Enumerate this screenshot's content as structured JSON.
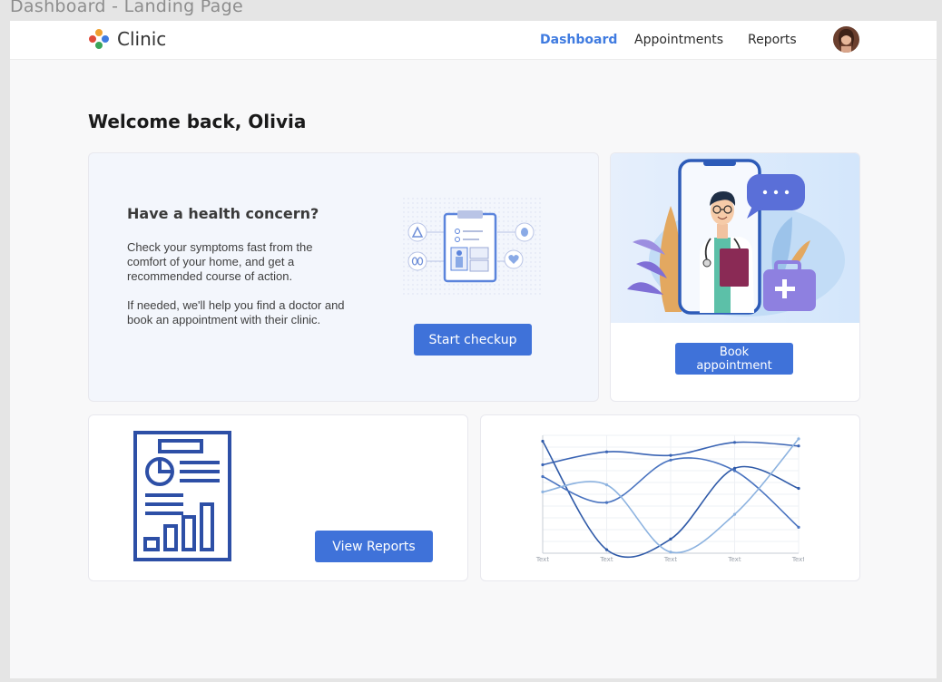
{
  "frame_title": "Dashboard - Landing Page",
  "header": {
    "app_name": "Clinic",
    "nav": [
      {
        "label": "Dashboard",
        "active": true
      },
      {
        "label": "Appointments",
        "active": false
      },
      {
        "label": "Reports",
        "active": false
      }
    ]
  },
  "welcome": "Welcome back, Olivia",
  "concern_card": {
    "title": "Have a health concern?",
    "paragraph1": "Check your symptoms fast from the comfort of your home, and get a recommended course of action.",
    "paragraph2": "If needed, we'll help you find a doctor and book an appointment with their clinic.",
    "button": "Start checkup"
  },
  "appointment_card": {
    "button": "Book appointment"
  },
  "reports_card": {
    "button": "View Reports"
  },
  "colors": {
    "accent": "#3f72d9",
    "nav_active": "#3f7be0"
  },
  "chart_data": {
    "type": "line",
    "categories": [
      "Text",
      "Text",
      "Text",
      "Text",
      "Text"
    ],
    "ylim": [
      0,
      1
    ],
    "series": [
      {
        "values": [
          0.75,
          0.86,
          0.83,
          0.94,
          0.91
        ],
        "color": "#3a64b4"
      },
      {
        "values": [
          0.95,
          0.03,
          0.12,
          0.72,
          0.55
        ],
        "color": "#2f5aa8"
      },
      {
        "values": [
          0.65,
          0.43,
          0.79,
          0.7,
          0.22
        ],
        "color": "#4a74c0"
      },
      {
        "values": [
          0.52,
          0.58,
          0.01,
          0.33,
          0.97
        ],
        "color": "#8db3e0"
      }
    ],
    "grid": true
  }
}
